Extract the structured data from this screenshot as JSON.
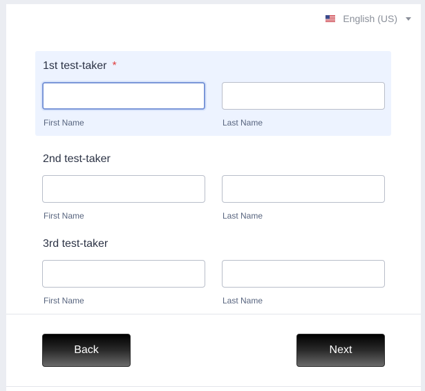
{
  "language": {
    "label": "English (US)",
    "flag_icon": "us-flag-icon"
  },
  "test_takers": [
    {
      "title": "1st test-taker",
      "required_mark": "*",
      "first_label": "First Name",
      "last_label": "Last Name"
    },
    {
      "title": "2nd test-taker",
      "first_label": "First Name",
      "last_label": "Last Name"
    },
    {
      "title": "3rd test-taker",
      "first_label": "First Name",
      "last_label": "Last Name"
    }
  ],
  "buttons": {
    "back": "Back",
    "next": "Next"
  },
  "colors": {
    "active_section_bg": "#edf3ff",
    "required": "#e03e3e",
    "button_gradient_top": "#000000",
    "button_gradient_bottom": "#6a6a6a"
  }
}
